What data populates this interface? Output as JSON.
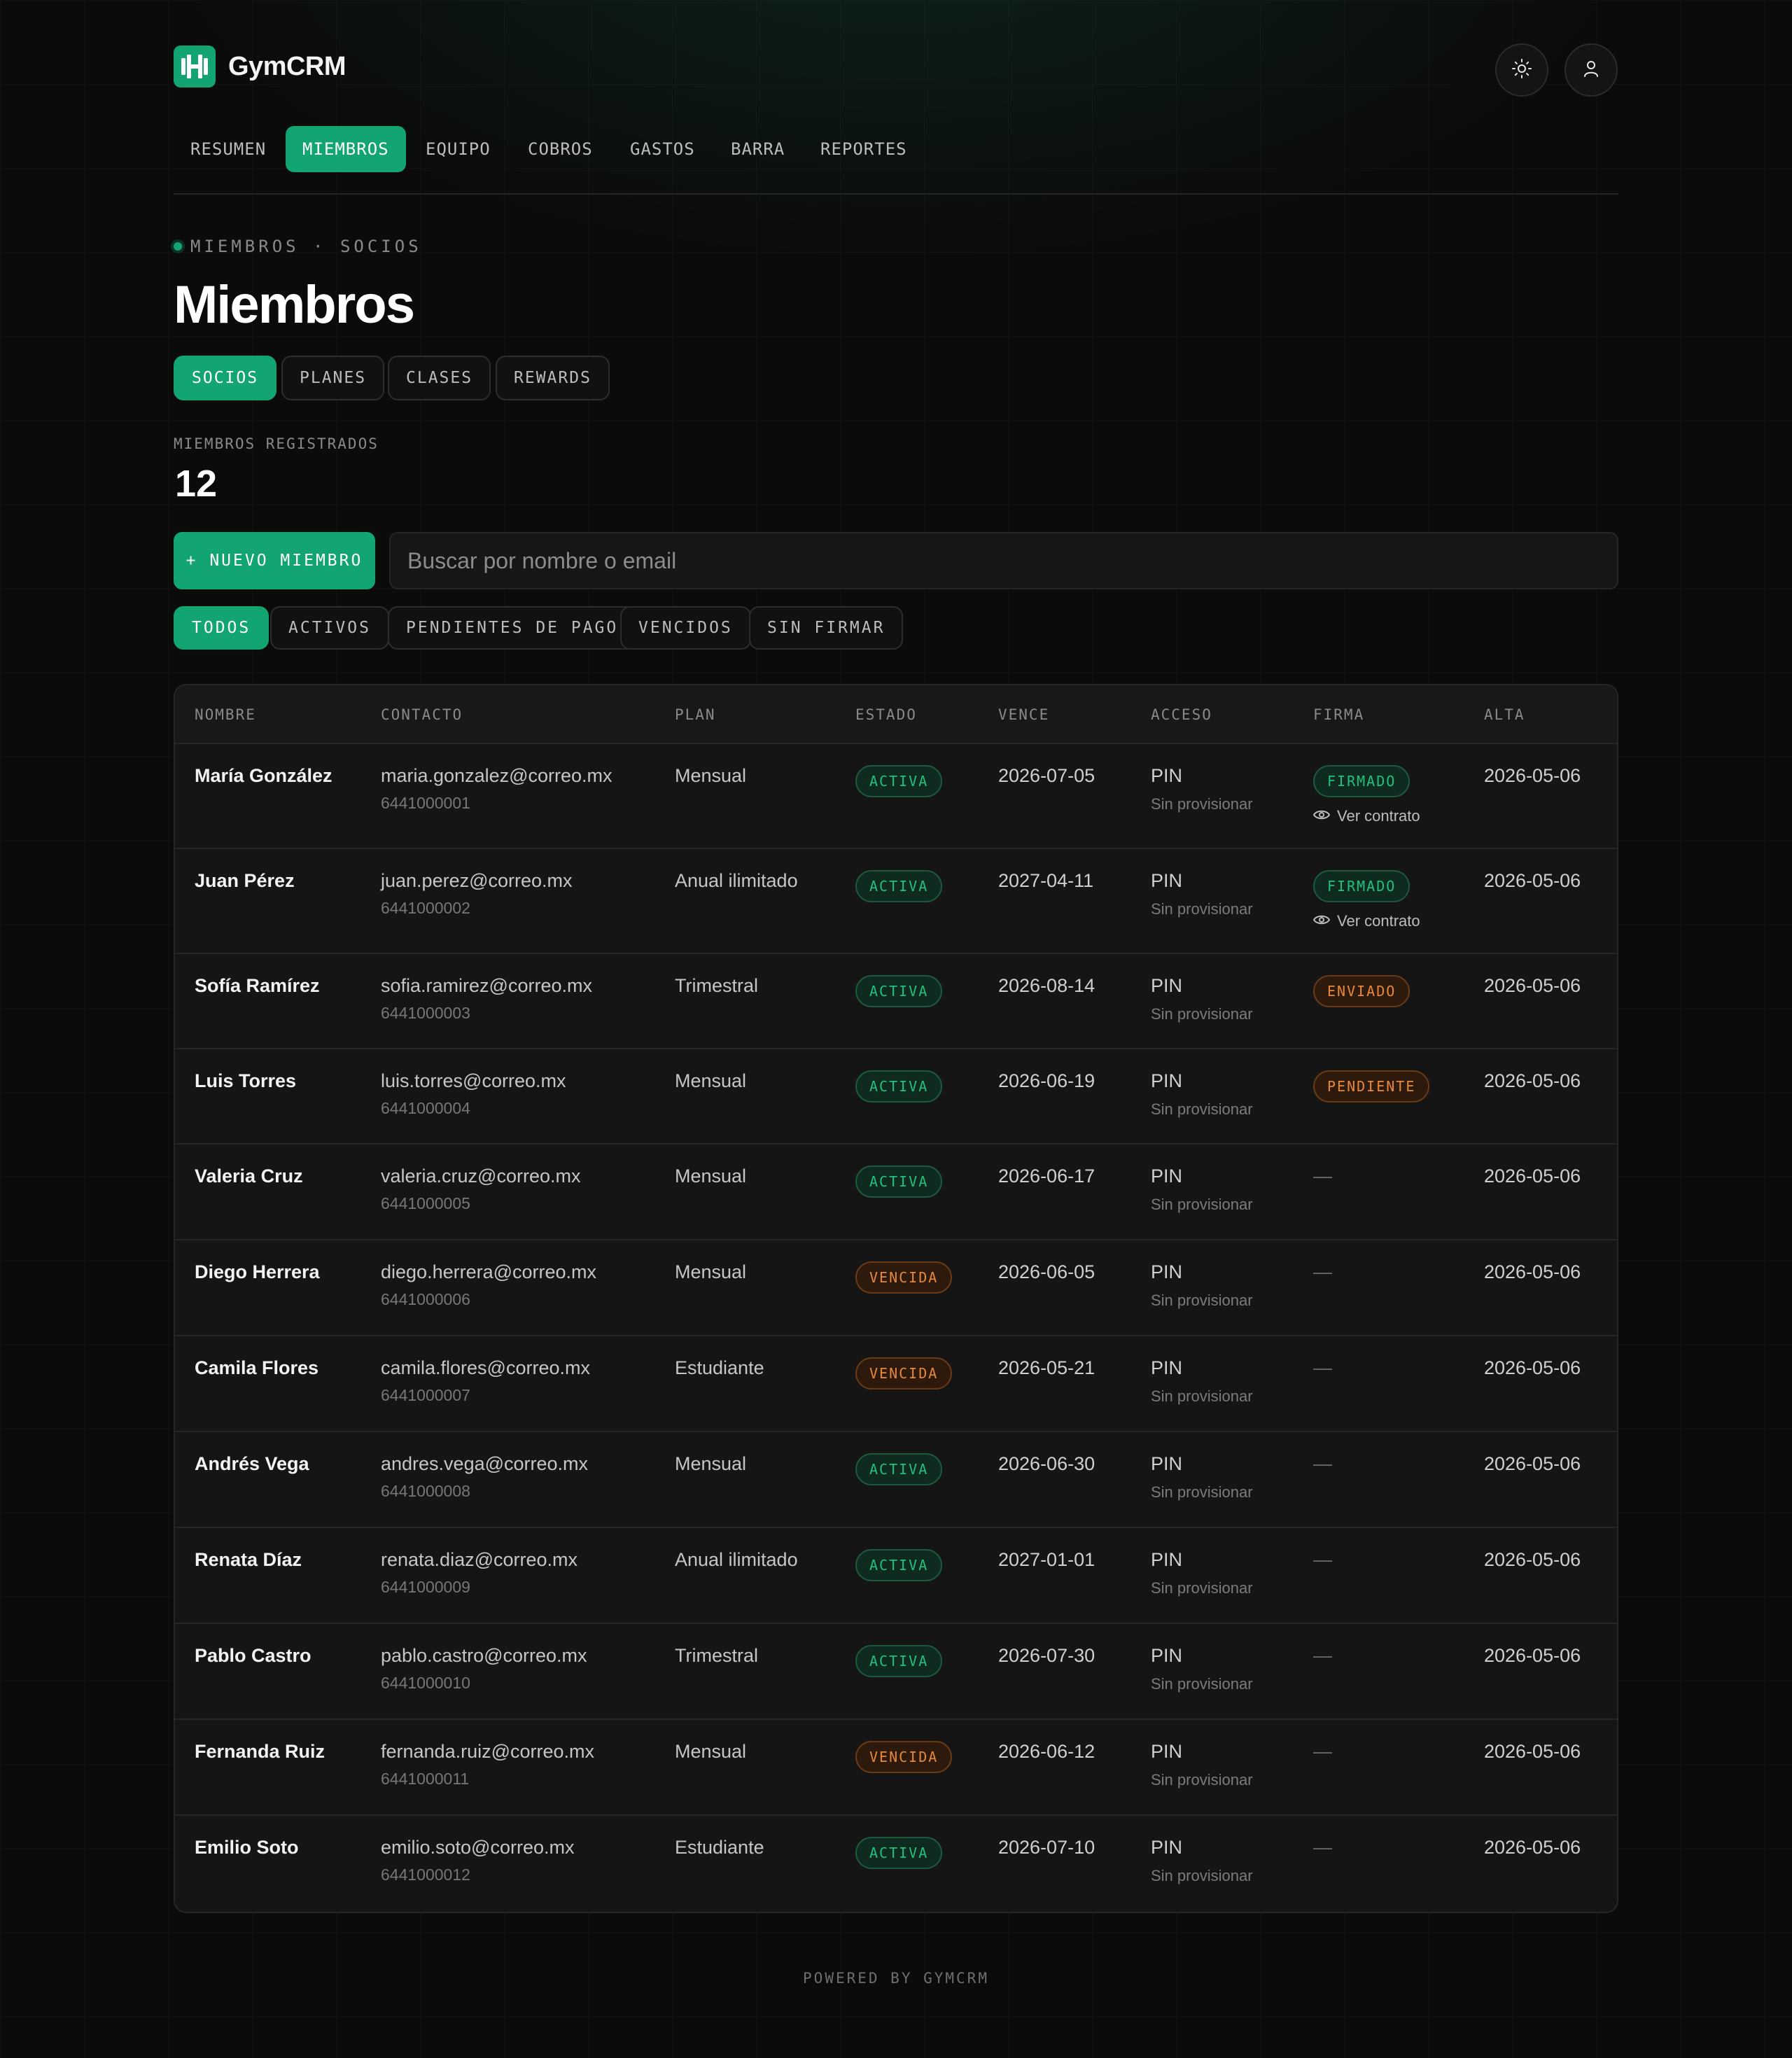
{
  "app": {
    "name": "GymCRM",
    "logo_icon": "dumbbell-logo-icon"
  },
  "header": {
    "theme_icon": "sun-icon",
    "user_icon": "user-icon"
  },
  "nav": {
    "items": [
      {
        "label": "RESUMEN",
        "active": false
      },
      {
        "label": "MIEMBROS",
        "active": true
      },
      {
        "label": "EQUIPO",
        "active": false
      },
      {
        "label": "COBROS",
        "active": false
      },
      {
        "label": "GASTOS",
        "active": false
      },
      {
        "label": "BARRA",
        "active": false
      },
      {
        "label": "REPORTES",
        "active": false
      }
    ]
  },
  "breadcrumb": "MIEMBROS · SOCIOS",
  "page_title": "Miembros",
  "subtabs": [
    {
      "label": "SOCIOS",
      "active": true
    },
    {
      "label": "PLANES",
      "active": false
    },
    {
      "label": "CLASES",
      "active": false
    },
    {
      "label": "REWARDS",
      "active": false
    }
  ],
  "stats": {
    "label": "MIEMBROS REGISTRADOS",
    "value": "12"
  },
  "actions": {
    "new_member": "+ NUEVO MIEMBRO",
    "search_placeholder": "Buscar por nombre o email"
  },
  "filters": [
    {
      "label": "TODOS",
      "active": true
    },
    {
      "label": "ACTIVOS",
      "active": false
    },
    {
      "label": "PENDIENTES DE PAGO",
      "active": false
    },
    {
      "label": "VENCIDOS",
      "active": false
    },
    {
      "label": "SIN FIRMAR",
      "active": false
    }
  ],
  "table": {
    "columns": [
      "NOMBRE",
      "CONTACTO",
      "PLAN",
      "ESTADO",
      "VENCE",
      "ACCESO",
      "FIRMA",
      "ALTA"
    ],
    "access_sub": "Sin provisionar",
    "view_contract": "Ver contrato",
    "rows": [
      {
        "name": "María González",
        "email": "maria.gonzalez@correo.mx",
        "phone": "6441000001",
        "plan": "Mensual",
        "status": "ACTIVA",
        "status_tone": "green",
        "expires": "2026-07-05",
        "access": "PIN",
        "signature": "FIRMADO",
        "signature_tone": "green",
        "has_contract": true,
        "created": "2026-05-06"
      },
      {
        "name": "Juan Pérez",
        "email": "juan.perez@correo.mx",
        "phone": "6441000002",
        "plan": "Anual ilimitado",
        "status": "ACTIVA",
        "status_tone": "green",
        "expires": "2027-04-11",
        "access": "PIN",
        "signature": "FIRMADO",
        "signature_tone": "green",
        "has_contract": true,
        "created": "2026-05-06"
      },
      {
        "name": "Sofía Ramírez",
        "email": "sofia.ramirez@correo.mx",
        "phone": "6441000003",
        "plan": "Trimestral",
        "status": "ACTIVA",
        "status_tone": "green",
        "expires": "2026-08-14",
        "access": "PIN",
        "signature": "ENVIADO",
        "signature_tone": "orange",
        "has_contract": false,
        "created": "2026-05-06"
      },
      {
        "name": "Luis Torres",
        "email": "luis.torres@correo.mx",
        "phone": "6441000004",
        "plan": "Mensual",
        "status": "ACTIVA",
        "status_tone": "green",
        "expires": "2026-06-19",
        "access": "PIN",
        "signature": "PENDIENTE",
        "signature_tone": "orange",
        "has_contract": false,
        "created": "2026-05-06"
      },
      {
        "name": "Valeria Cruz",
        "email": "valeria.cruz@correo.mx",
        "phone": "6441000005",
        "plan": "Mensual",
        "status": "ACTIVA",
        "status_tone": "green",
        "expires": "2026-06-17",
        "access": "PIN",
        "signature": "—",
        "signature_tone": "none",
        "has_contract": false,
        "created": "2026-05-06"
      },
      {
        "name": "Diego Herrera",
        "email": "diego.herrera@correo.mx",
        "phone": "6441000006",
        "plan": "Mensual",
        "status": "VENCIDA",
        "status_tone": "orange",
        "expires": "2026-06-05",
        "access": "PIN",
        "signature": "—",
        "signature_tone": "none",
        "has_contract": false,
        "created": "2026-05-06"
      },
      {
        "name": "Camila Flores",
        "email": "camila.flores@correo.mx",
        "phone": "6441000007",
        "plan": "Estudiante",
        "status": "VENCIDA",
        "status_tone": "orange",
        "expires": "2026-05-21",
        "access": "PIN",
        "signature": "—",
        "signature_tone": "none",
        "has_contract": false,
        "created": "2026-05-06"
      },
      {
        "name": "Andrés Vega",
        "email": "andres.vega@correo.mx",
        "phone": "6441000008",
        "plan": "Mensual",
        "status": "ACTIVA",
        "status_tone": "green",
        "expires": "2026-06-30",
        "access": "PIN",
        "signature": "—",
        "signature_tone": "none",
        "has_contract": false,
        "created": "2026-05-06"
      },
      {
        "name": "Renata Díaz",
        "email": "renata.diaz@correo.mx",
        "phone": "6441000009",
        "plan": "Anual ilimitado",
        "status": "ACTIVA",
        "status_tone": "green",
        "expires": "2027-01-01",
        "access": "PIN",
        "signature": "—",
        "signature_tone": "none",
        "has_contract": false,
        "created": "2026-05-06"
      },
      {
        "name": "Pablo Castro",
        "email": "pablo.castro@correo.mx",
        "phone": "6441000010",
        "plan": "Trimestral",
        "status": "ACTIVA",
        "status_tone": "green",
        "expires": "2026-07-30",
        "access": "PIN",
        "signature": "—",
        "signature_tone": "none",
        "has_contract": false,
        "created": "2026-05-06"
      },
      {
        "name": "Fernanda Ruiz",
        "email": "fernanda.ruiz@correo.mx",
        "phone": "6441000011",
        "plan": "Mensual",
        "status": "VENCIDA",
        "status_tone": "orange",
        "expires": "2026-06-12",
        "access": "PIN",
        "signature": "—",
        "signature_tone": "none",
        "has_contract": false,
        "created": "2026-05-06"
      },
      {
        "name": "Emilio Soto",
        "email": "emilio.soto@correo.mx",
        "phone": "6441000012",
        "plan": "Estudiante",
        "status": "ACTIVA",
        "status_tone": "green",
        "expires": "2026-07-10",
        "access": "PIN",
        "signature": "—",
        "signature_tone": "none",
        "has_contract": false,
        "created": "2026-05-06"
      }
    ]
  },
  "footer": "POWERED BY GYMCRM",
  "colors": {
    "accent": "#12a571",
    "status_green": "#22c07f",
    "status_orange": "#e8883a",
    "background": "#0b0b0b"
  }
}
